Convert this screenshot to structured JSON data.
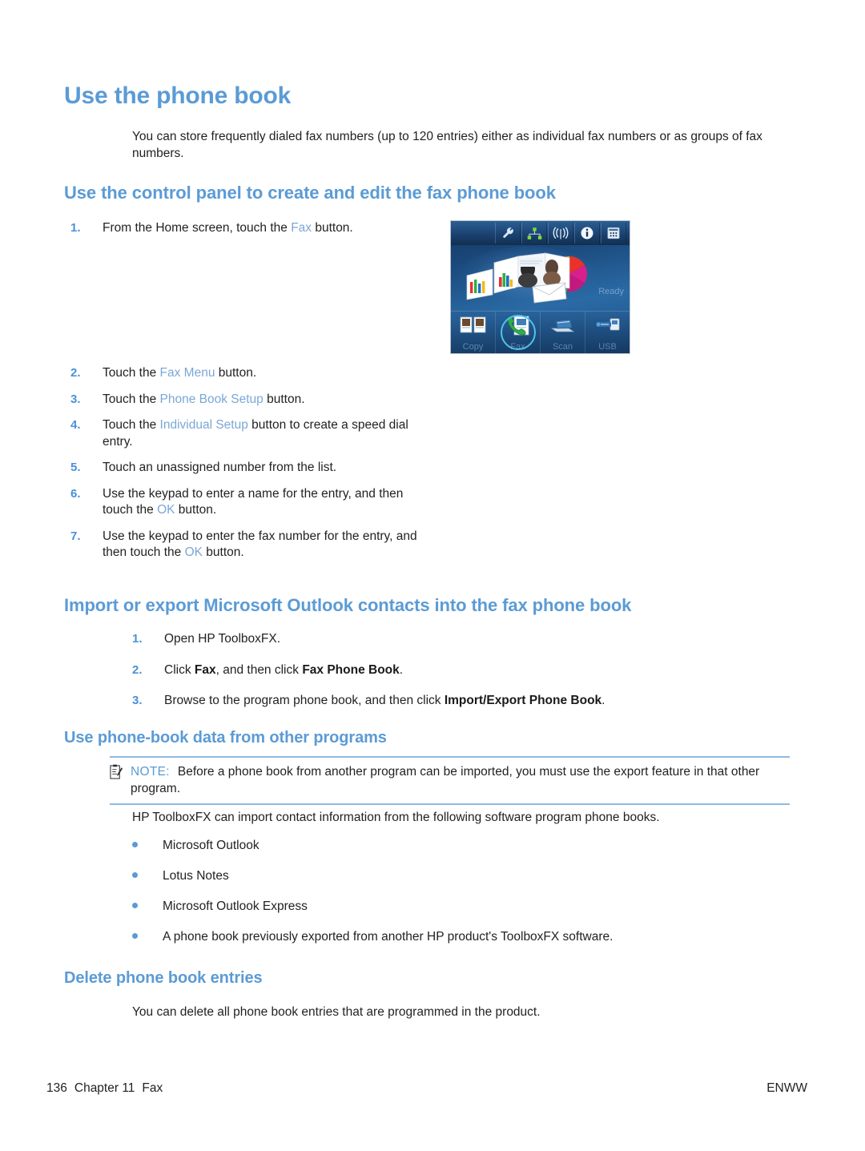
{
  "page": {
    "title": "Use the phone book",
    "intro": "You can store frequently dialed fax numbers (up to 120 entries) either as individual fax numbers or as groups of fax numbers."
  },
  "section_control_panel": {
    "heading": "Use the control panel to create and edit the fax phone book",
    "steps": [
      {
        "num": "1.",
        "pre": "From the Home screen, touch the ",
        "ui": "Fax",
        "post": " button."
      },
      {
        "num": "2.",
        "pre": "Touch the ",
        "ui": "Fax Menu",
        "post": " button."
      },
      {
        "num": "3.",
        "pre": "Touch the ",
        "ui": "Phone Book Setup",
        "post": " button."
      },
      {
        "num": "4.",
        "pre": "Touch the ",
        "ui": "Individual Setup",
        "post": " button to create a speed dial entry."
      },
      {
        "num": "5.",
        "pre": "Touch an unassigned number from the list.",
        "ui": "",
        "post": ""
      },
      {
        "num": "6.",
        "pre": "Use the keypad to enter a name for the entry, and then touch the ",
        "ui": "OK",
        "post": " button."
      },
      {
        "num": "7.",
        "pre": "Use the keypad to enter the fax number for the entry, and then touch the ",
        "ui": "OK",
        "post": " button."
      }
    ]
  },
  "control_panel_image": {
    "status_text": "Ready",
    "toolbar_icons": [
      "wrench-setup-icon",
      "network-icon",
      "wireless-icon",
      "info-icon",
      "supplies-icon"
    ],
    "buttons": [
      {
        "label": "Copy",
        "icon": "copy-icon",
        "highlighted": false
      },
      {
        "label": "Fax",
        "icon": "fax-icon",
        "highlighted": true
      },
      {
        "label": "Scan",
        "icon": "scan-icon",
        "highlighted": false
      },
      {
        "label": "USB",
        "icon": "usb-icon",
        "highlighted": false
      }
    ]
  },
  "section_outlook": {
    "heading": "Import or export Microsoft Outlook contacts into the fax phone book",
    "steps": [
      {
        "num": "1.",
        "parts": [
          {
            "t": "Open HP ToolboxFX.",
            "b": false
          }
        ]
      },
      {
        "num": "2.",
        "parts": [
          {
            "t": "Click ",
            "b": false
          },
          {
            "t": "Fax",
            "b": true
          },
          {
            "t": ", and then click ",
            "b": false
          },
          {
            "t": "Fax Phone Book",
            "b": true
          },
          {
            "t": ".",
            "b": false
          }
        ]
      },
      {
        "num": "3.",
        "parts": [
          {
            "t": "Browse to the program phone book, and then click ",
            "b": false
          },
          {
            "t": "Import/Export Phone Book",
            "b": true
          },
          {
            "t": ".",
            "b": false
          }
        ]
      }
    ]
  },
  "section_other_programs": {
    "heading": "Use phone-book data from other programs",
    "note": {
      "label": "NOTE:",
      "icon": "note-clipboard-icon",
      "text": "Before a phone book from another program can be imported, you must use the export feature in that other program."
    },
    "lead_in": "HP ToolboxFX can import contact information from the following software program phone books.",
    "bullets": [
      "Microsoft Outlook",
      "Lotus Notes",
      "Microsoft Outlook Express",
      "A phone book previously exported from another HP product's ToolboxFX software."
    ]
  },
  "section_delete": {
    "heading": "Delete phone book entries",
    "text": "You can delete all phone book entries that are programmed in the product."
  },
  "footer": {
    "page_number": "136",
    "chapter": "Chapter 11",
    "chapter_title": "Fax",
    "locale": "ENWW"
  },
  "colors": {
    "heading_blue": "#5b9bd5",
    "ui_term_blue": "#7ba7d7",
    "list_number_blue": "#4a90d9",
    "note_rule_blue": "#8fb9e0",
    "highlight_cyan": "#4ec3ea"
  }
}
